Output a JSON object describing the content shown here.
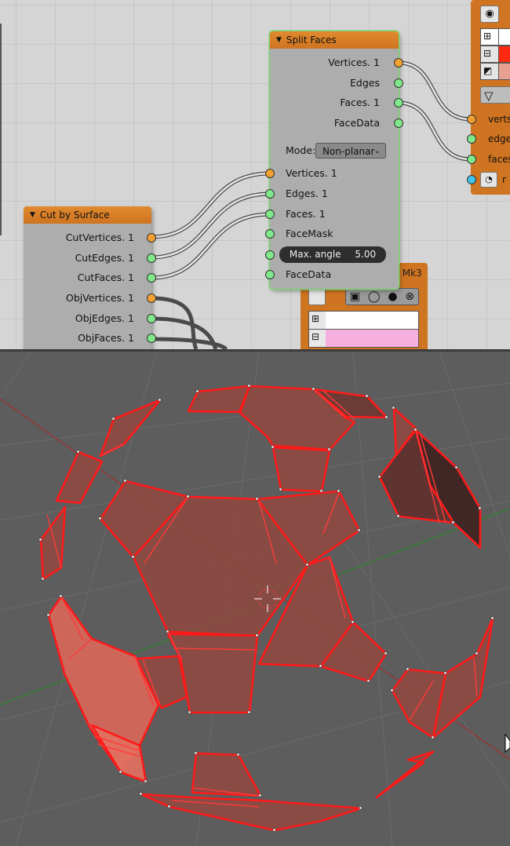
{
  "split_faces": {
    "title": "Split Faces",
    "outputs": [
      "Vertices. 1",
      "Edges",
      "Faces. 1",
      "FaceData"
    ],
    "mode_label": "Mode:",
    "mode_value": "Non-planar",
    "inputs": [
      "Vertices. 1",
      "Edges. 1",
      "Faces. 1",
      "FaceMask"
    ],
    "max_angle_label": "Max. angle",
    "max_angle_value": "5.00",
    "face_data_input": "FaceData"
  },
  "cut_by_surface": {
    "title": "Cut by Surface",
    "outputs": [
      "CutVertices. 1",
      "CutEdges. 1",
      "CutFaces. 1",
      "ObjVertices. 1",
      "ObjEdges. 1",
      "ObjFaces. 1"
    ]
  },
  "viewer_node": {
    "inputs": [
      "verts",
      "edges",
      "faces",
      "r"
    ],
    "colors": [
      "#ffffff",
      "#ff2a10",
      "#e8a090"
    ]
  },
  "viewer_draw": {
    "title": "Viewer Draw Mk3",
    "colors": [
      "#ffffff",
      "#f5b0e0"
    ]
  },
  "viewport": {
    "mesh_color": "#b0564a",
    "edge_color": "#ff1a1a",
    "grid_color": "#6b6b6b",
    "axis_x_color": "#a03030",
    "axis_y_color": "#2e8a2e"
  }
}
